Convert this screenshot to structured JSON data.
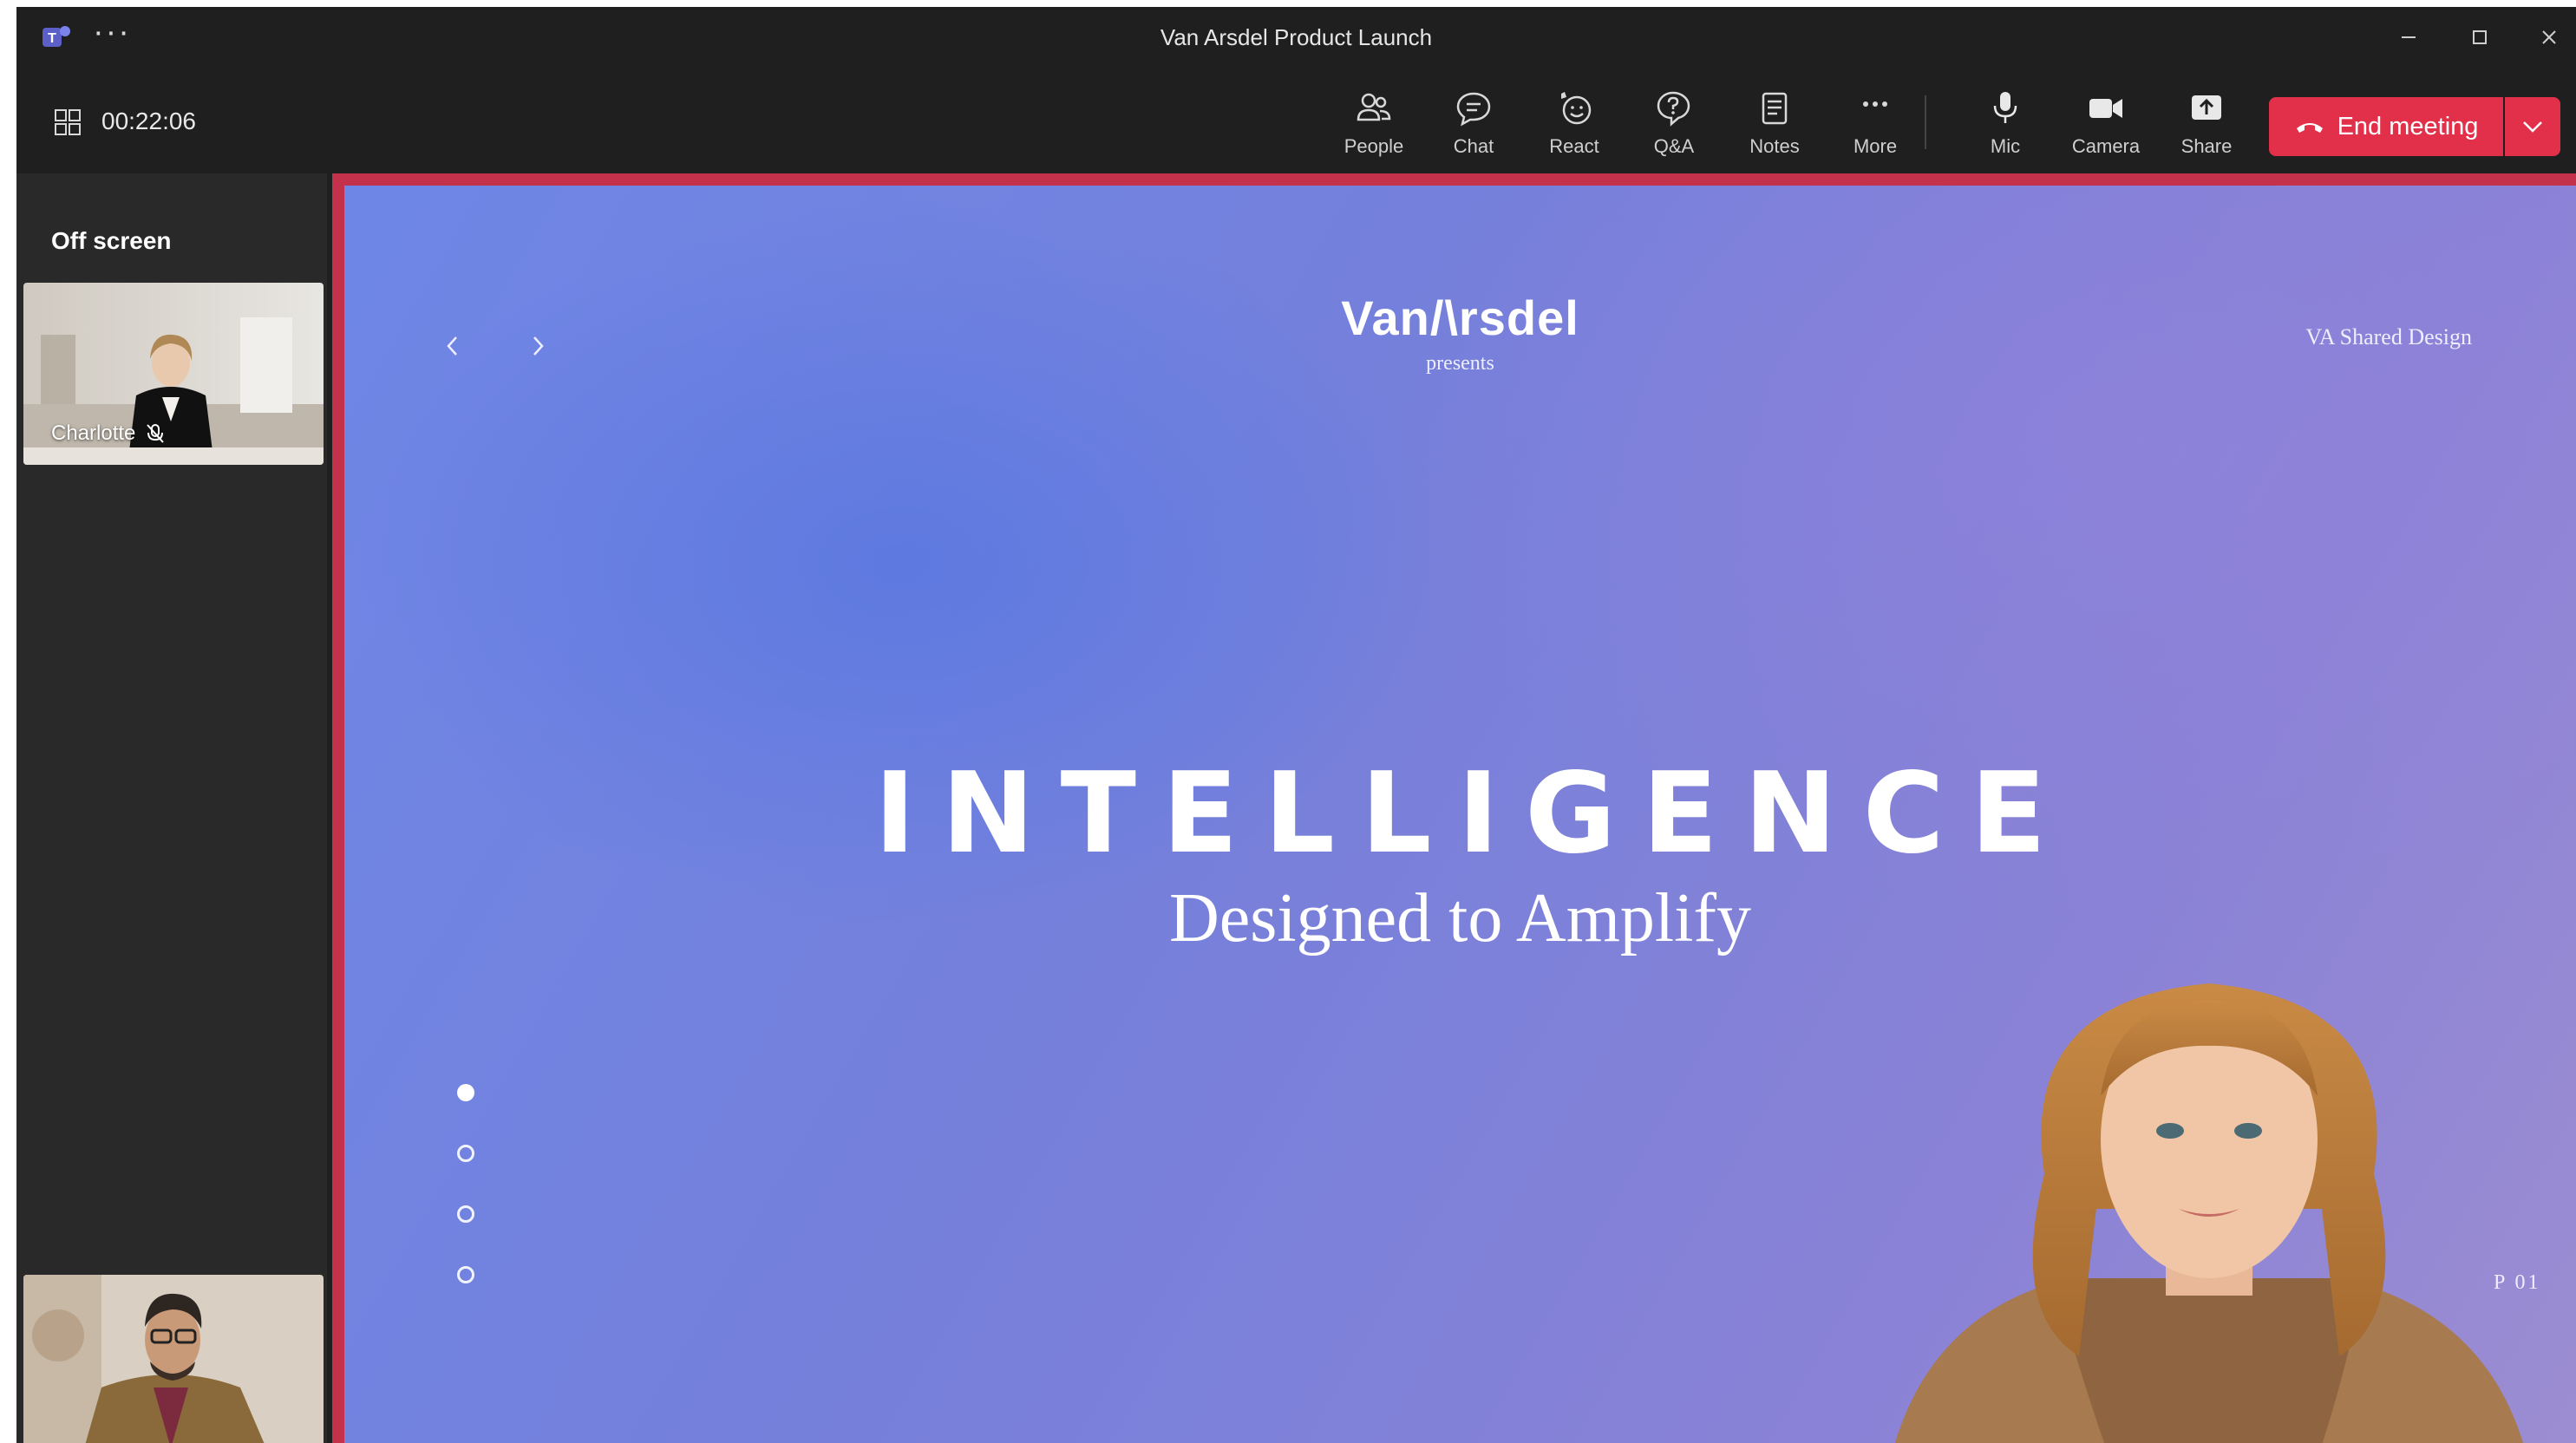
{
  "window": {
    "title": "Van Arsdel Product Launch",
    "more_label": "···"
  },
  "toolbar": {
    "timer": "00:22:06",
    "buttons": [
      {
        "id": "people",
        "label": "People",
        "icon": "people-icon"
      },
      {
        "id": "chat",
        "label": "Chat",
        "icon": "chat-icon"
      },
      {
        "id": "react",
        "label": "React",
        "icon": "react-icon"
      },
      {
        "id": "qa",
        "label": "Q&A",
        "icon": "qa-icon"
      },
      {
        "id": "notes",
        "label": "Notes",
        "icon": "notes-icon"
      },
      {
        "id": "more",
        "label": "More",
        "icon": "more-icon"
      },
      {
        "id": "mic",
        "label": "Mic",
        "icon": "mic-icon"
      },
      {
        "id": "camera",
        "label": "Camera",
        "icon": "camera-icon"
      },
      {
        "id": "share",
        "label": "Share",
        "icon": "share-icon"
      }
    ],
    "end_meeting_label": "End meeting"
  },
  "sidebar": {
    "title": "Off screen",
    "participants": [
      {
        "name": "Charlotte",
        "muted": true
      },
      {
        "name": "",
        "muted": false
      }
    ]
  },
  "slide": {
    "brand": "Van/\\rsdel",
    "presents": "presents",
    "corner_label": "VA Shared Design",
    "headline": "INTELLIGENCE",
    "subheadline": "Designed to Amplify",
    "page_number": "P 01",
    "active_dot": 0,
    "dot_count": 4
  },
  "colors": {
    "end_meeting": "#e3304a",
    "stage_border": "#c4314b",
    "chrome_bg": "#1f1f1f",
    "sidebar_bg": "#292929"
  }
}
